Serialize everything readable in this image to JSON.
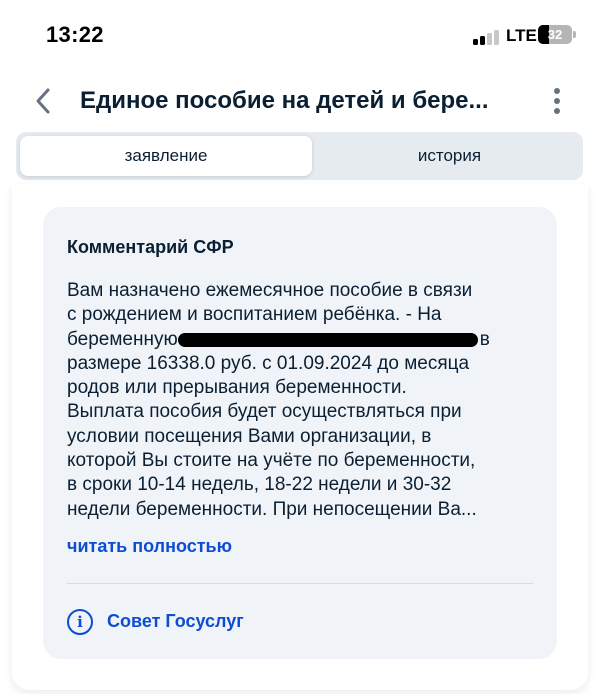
{
  "status_bar": {
    "time": "13:22",
    "network": "LTE",
    "battery_percent": "32",
    "battery_level": 0.32
  },
  "header": {
    "title": "Единое пособие на детей и бере...",
    "back_icon": "chevron-left-icon",
    "menu_icon": "kebab-menu-icon"
  },
  "tabs": [
    {
      "label": "заявление",
      "active": true
    },
    {
      "label": "история",
      "active": false
    }
  ],
  "comment": {
    "title": "Комментарий СФР",
    "lines": [
      "Вам назначено ежемесячное пособие в связи",
      "с рождением и воспитанием ребёнка. - На",
      "беременную",
      "в",
      "размере 16338.0 руб. с 01.09.2024 до месяца",
      "родов или прерывания беременности.",
      "Выплата пособия будет осуществляться при",
      "условии посещения Вами организации, в",
      "которой Вы стоите на учёте по беременности,",
      "в сроки 10-14 недель, 18-22 недели и 30-32",
      "недели беременности. При непосещении Ва..."
    ],
    "read_more": "читать полностью"
  },
  "advice": {
    "label": "Совет Госуслуг",
    "icon": "info-icon"
  },
  "colors": {
    "accent": "#0d4cd3",
    "text": "#0b1f33",
    "card_bg": "#f0f4f9",
    "tabs_bg": "#e6ebf0"
  }
}
